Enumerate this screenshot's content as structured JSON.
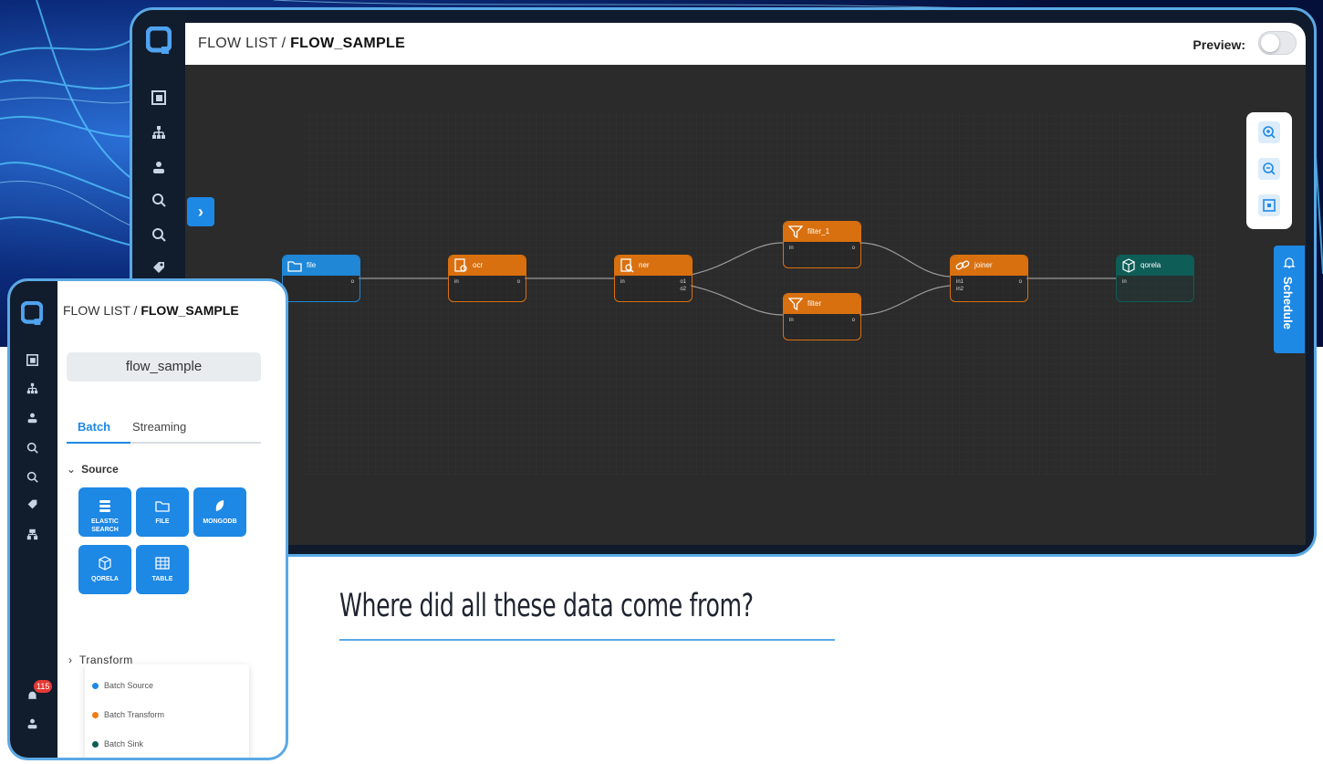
{
  "main_window": {
    "breadcrumb_prefix": "FLOW LIST /",
    "breadcrumb_current": "FLOW_SAMPLE",
    "preview_label": "Preview:",
    "preview_enabled": false,
    "schedule_label": "Schedule",
    "nodes": [
      {
        "title": "file",
        "kind": "source",
        "ports_in": [],
        "ports_out": [
          "o"
        ]
      },
      {
        "title": "ocr",
        "kind": "transform",
        "ports_in": [
          "in"
        ],
        "ports_out": [
          "o"
        ]
      },
      {
        "title": "ner",
        "kind": "transform",
        "ports_in": [
          "in"
        ],
        "ports_out": [
          "o1",
          "o2"
        ]
      },
      {
        "title": "filter_1",
        "kind": "transform",
        "ports_in": [
          "in"
        ],
        "ports_out": [
          "o"
        ]
      },
      {
        "title": "filter",
        "kind": "transform",
        "ports_in": [
          "in"
        ],
        "ports_out": [
          "o"
        ]
      },
      {
        "title": "joiner",
        "kind": "transform",
        "ports_in": [
          "in1",
          "in2"
        ],
        "ports_out": [
          "o"
        ]
      },
      {
        "title": "qorela",
        "kind": "sink",
        "ports_in": [
          "in"
        ],
        "ports_out": []
      }
    ]
  },
  "inset_window": {
    "breadcrumb_prefix": "FLOW LIST /",
    "breadcrumb_current": "FLOW_SAMPLE",
    "flow_name": "flow_sample",
    "tabs": [
      {
        "label": "Batch",
        "active": true
      },
      {
        "label": "Streaming",
        "active": false
      }
    ],
    "source_section": "Source",
    "source_tiles": [
      {
        "label": "ELASTIC SEARCH",
        "icon": "elasticsearch-icon"
      },
      {
        "label": "FILE",
        "icon": "folder-icon"
      },
      {
        "label": "MONGODB",
        "icon": "leaf-icon"
      },
      {
        "label": "QORELA",
        "icon": "cube-icon"
      },
      {
        "label": "TABLE",
        "icon": "table-icon"
      }
    ],
    "transform_section": "Transform",
    "legend": [
      {
        "label": "Batch Source",
        "color": "#1e88e5"
      },
      {
        "label": "Batch Transform",
        "color": "#f07b16"
      },
      {
        "label": "Batch Sink",
        "color": "#0f5d57"
      }
    ],
    "notification_count": "115"
  },
  "caption": "Where did all these data come from?",
  "colors": {
    "accent": "#1e88e5",
    "frame": "#5aa9e6",
    "source_node": "#1f87d6",
    "transform_node": "#d9700f",
    "sink_node": "#0f5d57",
    "canvas": "#2b2b2b",
    "rail": "#111c2d"
  }
}
